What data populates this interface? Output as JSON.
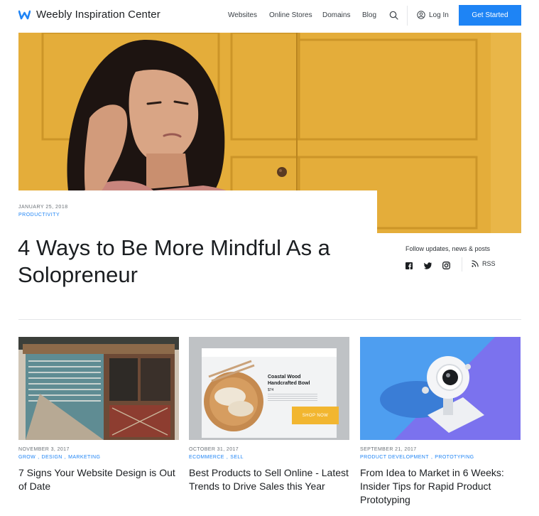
{
  "header": {
    "brand": "Weebly Inspiration Center",
    "nav": [
      "Websites",
      "Online Stores",
      "Domains",
      "Blog"
    ],
    "login": "Log In",
    "cta": "Get Started"
  },
  "hero": {
    "date": "JANUARY 25, 2018",
    "category": "PRODUCTIVITY",
    "title": "4 Ways to Be More Mindful As a Solopreneur"
  },
  "follow": {
    "label": "Follow updates, news & posts",
    "icons": [
      "facebook-icon",
      "twitter-icon",
      "instagram-icon"
    ],
    "rss": "RSS"
  },
  "cards": [
    {
      "date": "NOVEMBER 3, 2017",
      "tags": [
        "GROW",
        "DESIGN",
        "MARKETING"
      ],
      "title": "7 Signs Your Website Design is Out of Date"
    },
    {
      "date": "OCTOBER 31, 2017",
      "tags": [
        "ECOMMERCE",
        "SELL"
      ],
      "title": "Best Products to Sell Online - Latest Trends to Drive Sales this Year",
      "mock": {
        "product": "Coastal Wood Handcrafted Bowl",
        "price": "$74",
        "button": "SHOP NOW"
      }
    },
    {
      "date": "SEPTEMBER 21, 2017",
      "tags": [
        "PRODUCT DEVELOPMENT",
        "PROTOTYPING"
      ],
      "title": "From Idea to Market in 6 Weeks: Insider Tips for Rapid Product Prototyping"
    }
  ],
  "colors": {
    "accent": "#1e84f5",
    "hero_bg": "#e4ad3a"
  }
}
